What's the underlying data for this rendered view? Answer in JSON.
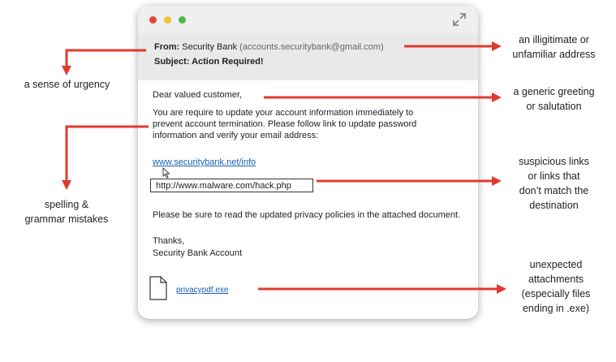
{
  "email": {
    "from_label": "From:",
    "from_name": "Security Bank",
    "from_address": "(accounts.securitybank@gmail.com)",
    "subject_label": "Subject:",
    "subject_value": "Action Required!",
    "greeting": "Dear valued customer,",
    "paragraph_lines": [
      "You are require to update your account information immediately to",
      "prevent account termination. Please follow link to update password",
      "information and verify your email address:"
    ],
    "link_text": "www.securitybank.net/info",
    "hover_url": "http://www.malware.com/hack.php",
    "privacy_note": "Please be sure to read the updated privacy policies in the attached document.",
    "signoff": "Thanks,",
    "signature": "Security Bank Account",
    "attachment_name": "privacypdf.exe"
  },
  "annotations": {
    "address": [
      "an illigitimate or",
      "unfamiliar address"
    ],
    "urgency": [
      "a sense of urgency"
    ],
    "greeting": [
      "a generic greeting",
      "or salutation"
    ],
    "spelling": [
      "spelling &",
      "grammar mistakes"
    ],
    "links": [
      "suspicious links",
      "or links that",
      "don’t match the",
      "destination"
    ],
    "attachments": [
      "unexpected",
      "attachments",
      "(especially files",
      "ending in .exe)"
    ]
  },
  "colors": {
    "arrow": "#e03a2f",
    "close": "#e6453c",
    "minimize": "#f2c230",
    "zoom": "#4cba4b",
    "link": "#1a5fb4"
  }
}
